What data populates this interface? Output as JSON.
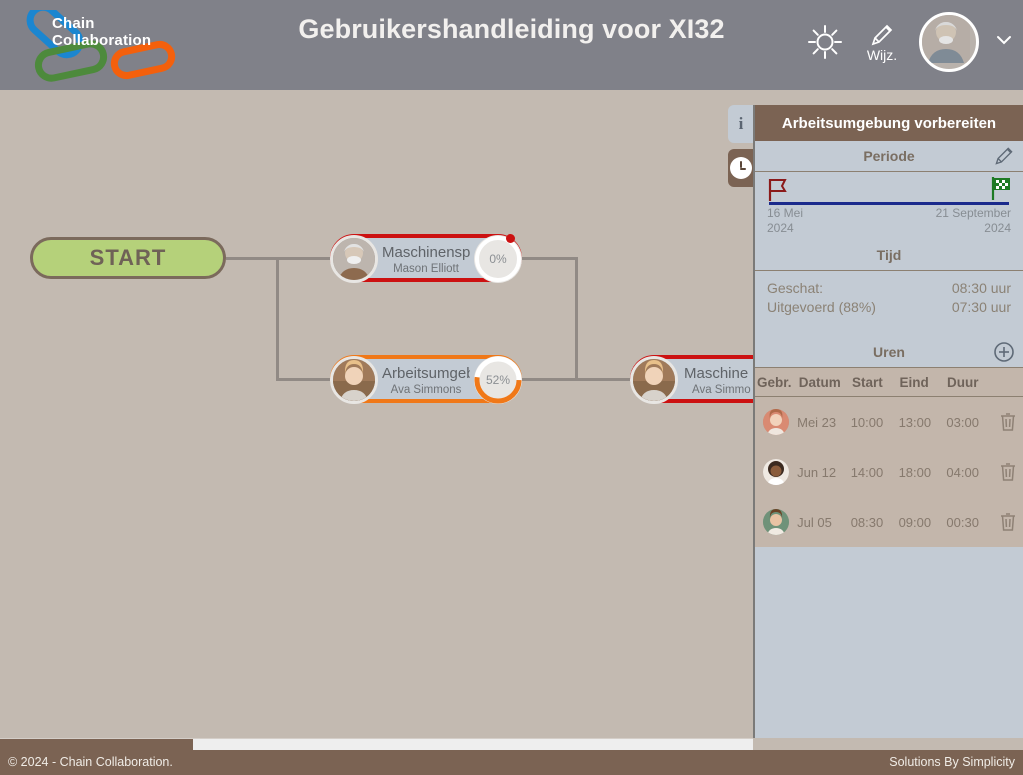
{
  "header": {
    "logo_line1": "Chain",
    "logo_line2": "Collaboration",
    "title": "Gebruikershandleiding voor XI32",
    "theme_icon": "sun-icon",
    "edit_icon": "pencil-icon",
    "edit_label": "Wijz.",
    "avatar_icon": "user-avatar",
    "chevron_icon": "chevron-down-icon"
  },
  "side_tabs": [
    {
      "name": "info",
      "label": "i",
      "icon": "info-icon",
      "active": false
    },
    {
      "name": "time",
      "label": "",
      "icon": "clock-icon",
      "active": true
    }
  ],
  "flow": {
    "start_label": "START",
    "nodes": [
      {
        "title": "Maschinenspezi…",
        "person": "Mason Elliott",
        "progress": "0%",
        "progress_value": 0,
        "color": "#cc1111",
        "alert": true
      },
      {
        "title": "Arbeitsumgebun…",
        "person": "Ava Simmons",
        "progress": "52%",
        "progress_value": 52,
        "color": "#f07818",
        "alert": false
      },
      {
        "title": "Maschine ei",
        "person": "Ava Simmo",
        "progress": "",
        "progress_value": 0,
        "color": "#cc1111",
        "alert": false
      }
    ]
  },
  "panel": {
    "title": "Arbeitsumgebung vorbereiten",
    "periode": {
      "heading": "Periode",
      "edit_icon": "pencil-icon",
      "start_flag_icon": "flag-start-icon",
      "end_flag_icon": "flag-checkered-icon",
      "start_date": "16 Mei",
      "start_year": "2024",
      "end_date": "21 September",
      "end_year": "2024"
    },
    "tijd": {
      "heading": "Tijd",
      "rows": [
        {
          "label": "Geschat:",
          "value": "08:30 uur"
        },
        {
          "label": "Uitgevoerd (88%)",
          "value": "07:30 uur"
        }
      ]
    },
    "uren": {
      "heading": "Uren",
      "add_icon": "plus-circle-icon",
      "columns": [
        "Gebr.",
        "Datum",
        "Start",
        "Eind",
        "Duur"
      ],
      "rows": [
        {
          "avatar": "user-avatar",
          "date": "Mei 23",
          "start": "10:00",
          "end": "13:00",
          "duration": "03:00",
          "delete_icon": "trash-icon"
        },
        {
          "avatar": "user-avatar",
          "date": "Jun 12",
          "start": "14:00",
          "end": "18:00",
          "duration": "04:00",
          "delete_icon": "trash-icon"
        },
        {
          "avatar": "user-avatar",
          "date": "Jul 05",
          "start": "08:30",
          "end": "09:00",
          "duration": "00:30",
          "delete_icon": "trash-icon"
        }
      ]
    }
  },
  "footer": {
    "copyright": "© 2024 - Chain Collaboration.",
    "credit": "Solutions By Simplicity"
  },
  "colors": {
    "header_bg": "#808189",
    "canvas_bg": "#c3bab1",
    "panel_bg": "#c3cbd4",
    "brown": "#7b6353",
    "start_green": "#b5d17a",
    "accent_orange": "#f07818",
    "accent_red": "#cc1111",
    "timeline_blue": "#1a2a8c"
  }
}
